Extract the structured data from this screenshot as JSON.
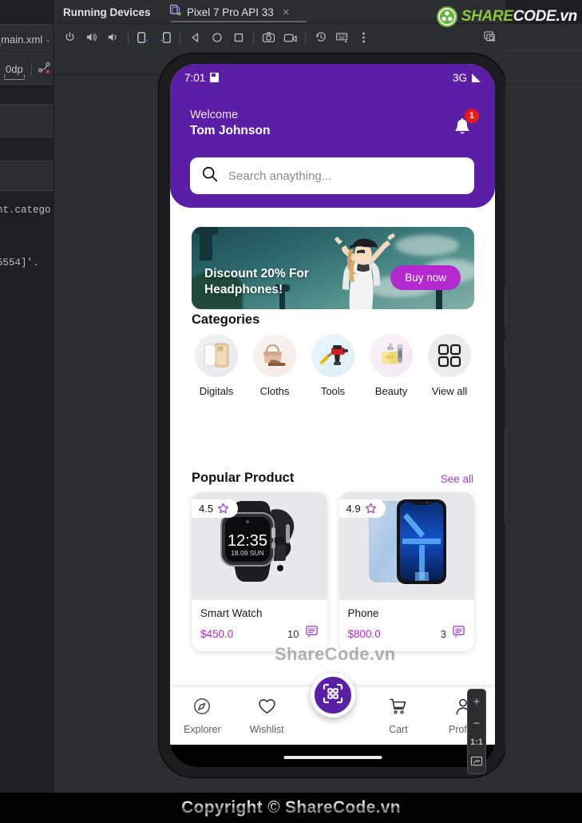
{
  "ide": {
    "left_editor": {
      "tab_label": "_main.xml",
      "tab_caret": "⌄",
      "constraint_value": "0dp",
      "code_fragment_1": "nt.catego",
      "code_fragment_2": "5554]'."
    },
    "emulator_panel": {
      "title": "Running Devices",
      "device_tab": "Pixel 7 Pro API 33",
      "close_label": "×",
      "toolbar_icons": [
        "power-icon",
        "volume-up-icon",
        "volume-down-icon",
        "rotate-left-icon",
        "rotate-right-icon",
        "back-icon",
        "home-icon",
        "overview-icon",
        "screenshot-icon",
        "record-icon",
        "history-icon",
        "keyboard-icon",
        "more-options-icon"
      ],
      "inspect_icon": "inspect-icon"
    },
    "zoom_controls": {
      "zoom_in": "+",
      "zoom_out": "−",
      "actual_size": "1:1",
      "fit_label": "fit-to-screen-icon"
    },
    "branding": {
      "logo_share": "SHARE",
      "logo_code": "CODE",
      "logo_tld": ".vn",
      "logo_icon": "sharecode-logo-icon"
    }
  },
  "watermarks": {
    "center": "ShareCode.vn",
    "bottom": "Copyright © ShareCode.vn"
  },
  "app": {
    "status_bar": {
      "time": "7:01",
      "sim_icon": "sim-card-icon",
      "network": "3G",
      "signal_icon": "signal-bars-icon"
    },
    "header": {
      "greeting": "Welcome",
      "user_name": "Tom Johnson",
      "bell_icon": "notification-bell-icon",
      "bell_badge": "1",
      "accent_color": "#5b1fa5"
    },
    "search": {
      "placeholder": "Search anaything...",
      "icon": "search-icon"
    },
    "banner": {
      "headline_line1": "Discount 20% For",
      "headline_line2": "Headphones!",
      "cta_label": "Buy now",
      "cta_color": "#b429cf"
    },
    "categories": {
      "title": "Categories",
      "items": [
        {
          "label": "Digitals",
          "icon": "smartphone-category-icon"
        },
        {
          "label": "Cloths",
          "icon": "handbag-shoe-category-icon"
        },
        {
          "label": "Tools",
          "icon": "drill-category-icon"
        },
        {
          "label": "Beauty",
          "icon": "perfume-shaver-category-icon"
        },
        {
          "label": "View all",
          "icon": "grid-view-all-icon"
        }
      ]
    },
    "popular": {
      "title": "Popular Product",
      "see_all": "See all",
      "link_color": "#9c3fc4",
      "products": [
        {
          "name": "Smart Watch",
          "price": "$450.0",
          "rating": "4.5",
          "comments": "10",
          "image": "smart-watch-image",
          "watch_time": "12:35",
          "watch_date": "18.09 SUN"
        },
        {
          "name": "Phone",
          "price": "$800.0",
          "rating": "4.9",
          "comments": "3",
          "image": "phone-image"
        }
      ]
    },
    "bottom_nav": {
      "fab_icon": "qr-scan-icon",
      "items": [
        {
          "label": "Explorer",
          "icon": "compass-icon"
        },
        {
          "label": "Wishlist",
          "icon": "heart-icon"
        },
        {
          "label": "Cart",
          "icon": "shopping-cart-icon"
        },
        {
          "label": "Profile",
          "icon": "person-icon"
        }
      ]
    }
  }
}
